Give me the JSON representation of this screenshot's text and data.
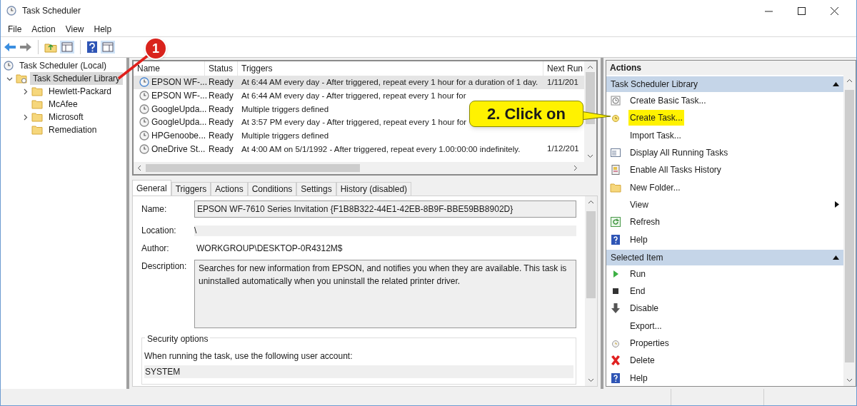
{
  "window": {
    "title": "Task Scheduler"
  },
  "menu": [
    "File",
    "Action",
    "View",
    "Help"
  ],
  "tree": [
    {
      "label": "Task Scheduler (Local)",
      "selected": false,
      "children": [
        {
          "label": "Task Scheduler Library",
          "selected": true,
          "expanded": true,
          "children": [
            {
              "label": "Hewlett-Packard",
              "selected": false,
              "expandable": true
            },
            {
              "label": "McAfee",
              "selected": false,
              "expandable": false
            },
            {
              "label": "Microsoft",
              "selected": false,
              "expandable": true
            },
            {
              "label": "Remediation",
              "selected": false,
              "expandable": false
            }
          ]
        }
      ]
    }
  ],
  "task_table": {
    "columns": [
      "Name",
      "Status",
      "Triggers",
      "Next Run"
    ],
    "rows": [
      {
        "name": "EPSON WF-...",
        "status": "Ready",
        "triggers": "At 6:44 AM every day - After triggered, repeat every 1 hour for a duration of 1 day.",
        "next_run": "1/11/201",
        "selected": true
      },
      {
        "name": "EPSON WF-...",
        "status": "Ready",
        "triggers": "At 6:44 AM every day - After triggered, repeat every 1 hour for",
        "selected": false
      },
      {
        "name": "GoogleUpda...",
        "status": "Ready",
        "triggers": "Multiple triggers defined",
        "selected": false
      },
      {
        "name": "GoogleUpda...",
        "status": "Ready",
        "triggers": "At 3:57 PM every day - After triggered, repeat every 1 hour for",
        "selected": false
      },
      {
        "name": "HPGenoobe...",
        "status": "Ready",
        "triggers": "Multiple triggers defined",
        "selected": false
      },
      {
        "name": "OneDrive St...",
        "status": "Ready",
        "triggers": "At 4:00 AM on 5/1/1992 - After triggered, repeat every 1.00:00:00 indefinitely.",
        "next_run": "1/12/201",
        "selected": false
      }
    ]
  },
  "detail_tabs": [
    {
      "label": "General",
      "selected": true
    },
    {
      "label": "Triggers",
      "selected": false
    },
    {
      "label": "Actions",
      "selected": false
    },
    {
      "label": "Conditions",
      "selected": false
    },
    {
      "label": "Settings",
      "selected": false
    },
    {
      "label": "History (disabled)",
      "selected": false
    }
  ],
  "general": {
    "name_label": "Name:",
    "name_value": "EPSON WF-7610 Series Invitation {F1B8B322-44E1-42EB-8B9F-BBE59BB8902D}",
    "location_label": "Location:",
    "location_value": "\\",
    "author_label": "Author:",
    "author_value": "WORKGROUP\\DESKTOP-0R4312M$",
    "description_label": "Description:",
    "description_value": "Searches for new information from EPSON, and notifies you when they are available. This task is uninstalled automatically when you uninstall the related printer driver.",
    "security_title": "Security options",
    "security_text": "When running the task, use the following user account:",
    "account": "SYSTEM"
  },
  "actions_pane": {
    "title": "Actions",
    "sections": [
      {
        "title": "Task Scheduler Library",
        "expanded": true,
        "items": [
          {
            "label": "Create Basic Task...",
            "highlighted": false,
            "submenu": false
          },
          {
            "label": "Create Task...",
            "highlighted": true,
            "submenu": false
          },
          {
            "label": "Import Task...",
            "highlighted": false,
            "submenu": false
          },
          {
            "label": "Display All Running Tasks",
            "highlighted": false,
            "submenu": false
          },
          {
            "label": "Enable All Tasks History",
            "highlighted": false,
            "submenu": false
          },
          {
            "label": "New Folder...",
            "highlighted": false,
            "submenu": false
          },
          {
            "label": "View",
            "highlighted": false,
            "submenu": true
          },
          {
            "label": "Refresh",
            "highlighted": false,
            "submenu": false
          },
          {
            "label": "Help",
            "highlighted": false,
            "submenu": false
          }
        ]
      },
      {
        "title": "Selected Item",
        "expanded": true,
        "items": [
          {
            "label": "Run",
            "highlighted": false,
            "submenu": false
          },
          {
            "label": "End",
            "highlighted": false,
            "submenu": false
          },
          {
            "label": "Disable",
            "highlighted": false,
            "submenu": false
          },
          {
            "label": "Export...",
            "highlighted": false,
            "submenu": false
          },
          {
            "label": "Properties",
            "highlighted": false,
            "submenu": false
          },
          {
            "label": "Delete",
            "highlighted": false,
            "submenu": false
          },
          {
            "label": "Help",
            "highlighted": false,
            "submenu": false
          }
        ]
      }
    ]
  },
  "callouts": [
    {
      "kind": "badge",
      "text": "1"
    },
    {
      "kind": "note",
      "text": "2. Click on"
    }
  ]
}
